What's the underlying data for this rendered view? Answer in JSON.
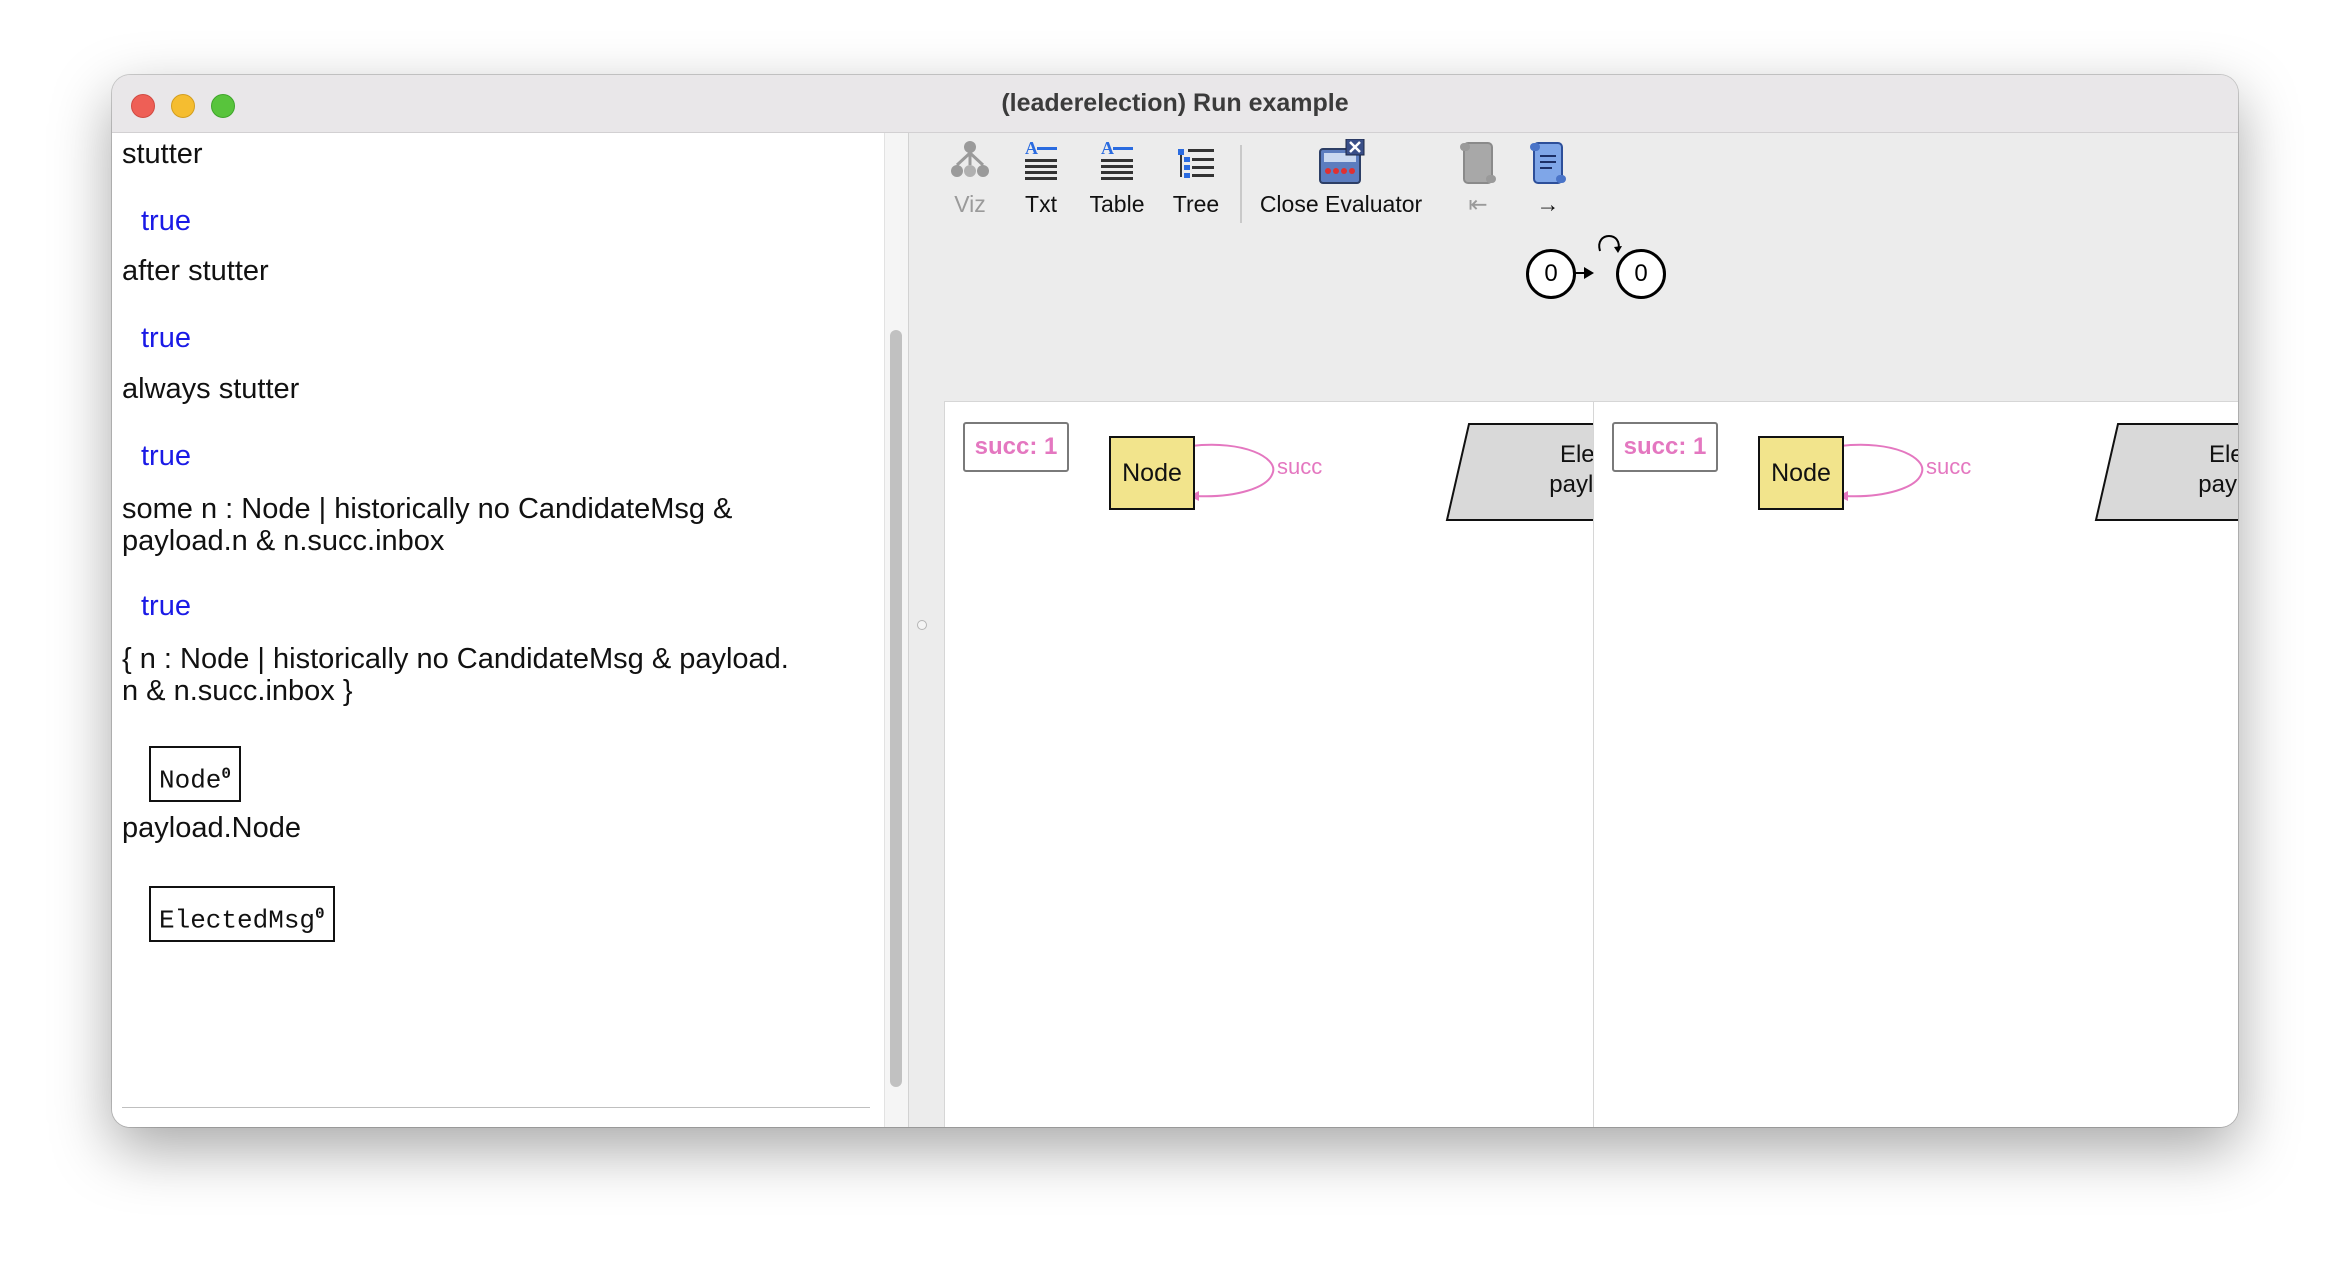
{
  "window": {
    "title": "(leaderelection) Run example"
  },
  "evaluator": {
    "lines": [
      {
        "expr": "stutter",
        "result": "true"
      },
      {
        "expr": "after stutter",
        "result": "true"
      },
      {
        "expr": "always stutter",
        "result": "true"
      },
      {
        "expr_line1": "some n : Node | historically no CandidateMsg &",
        "expr_line2": "payload.n & n.succ.inbox",
        "result": "true"
      },
      {
        "expr_line1": "{ n : Node | historically no CandidateMsg & payload.",
        "expr_line2": "n & n.succ.inbox }",
        "atom_name": "Node",
        "atom_sup": "0"
      },
      {
        "expr": "payload.Node",
        "atom_name": "ElectedMsg",
        "atom_sup": "0"
      }
    ],
    "input_value": ""
  },
  "toolbar": {
    "buttons": [
      {
        "label": "Viz",
        "icon": "viz-icon",
        "enabled": false
      },
      {
        "label": "Txt",
        "icon": "txt-icon",
        "enabled": true
      },
      {
        "label": "Table",
        "icon": "table-icon",
        "enabled": true
      },
      {
        "label": "Tree",
        "icon": "tree-icon",
        "enabled": true
      },
      {
        "label": "Close Evaluator",
        "icon": "close-evaluator-icon",
        "enabled": true
      },
      {
        "label": "⇤",
        "icon": "scroll-back-icon",
        "enabled": false
      },
      {
        "label": "→",
        "icon": "scroll-forward-icon",
        "enabled": true
      }
    ]
  },
  "trace": {
    "state_left": "0",
    "state_right": "0"
  },
  "panels": [
    {
      "succ_label": "succ: 1",
      "node_label": "Node",
      "edge_label": "succ",
      "elected_line1": "Elected",
      "elected_line2": "payload:"
    },
    {
      "succ_label": "succ: 1",
      "node_label": "Node",
      "edge_label": "succ",
      "elected_line1": "Elected",
      "elected_line2": "payload:"
    }
  ],
  "colors": {
    "result_blue": "#1a1ae6",
    "node_fill": "#f2e48c",
    "edge_pink": "#e477c0",
    "elected_fill": "#d9d9d9"
  }
}
